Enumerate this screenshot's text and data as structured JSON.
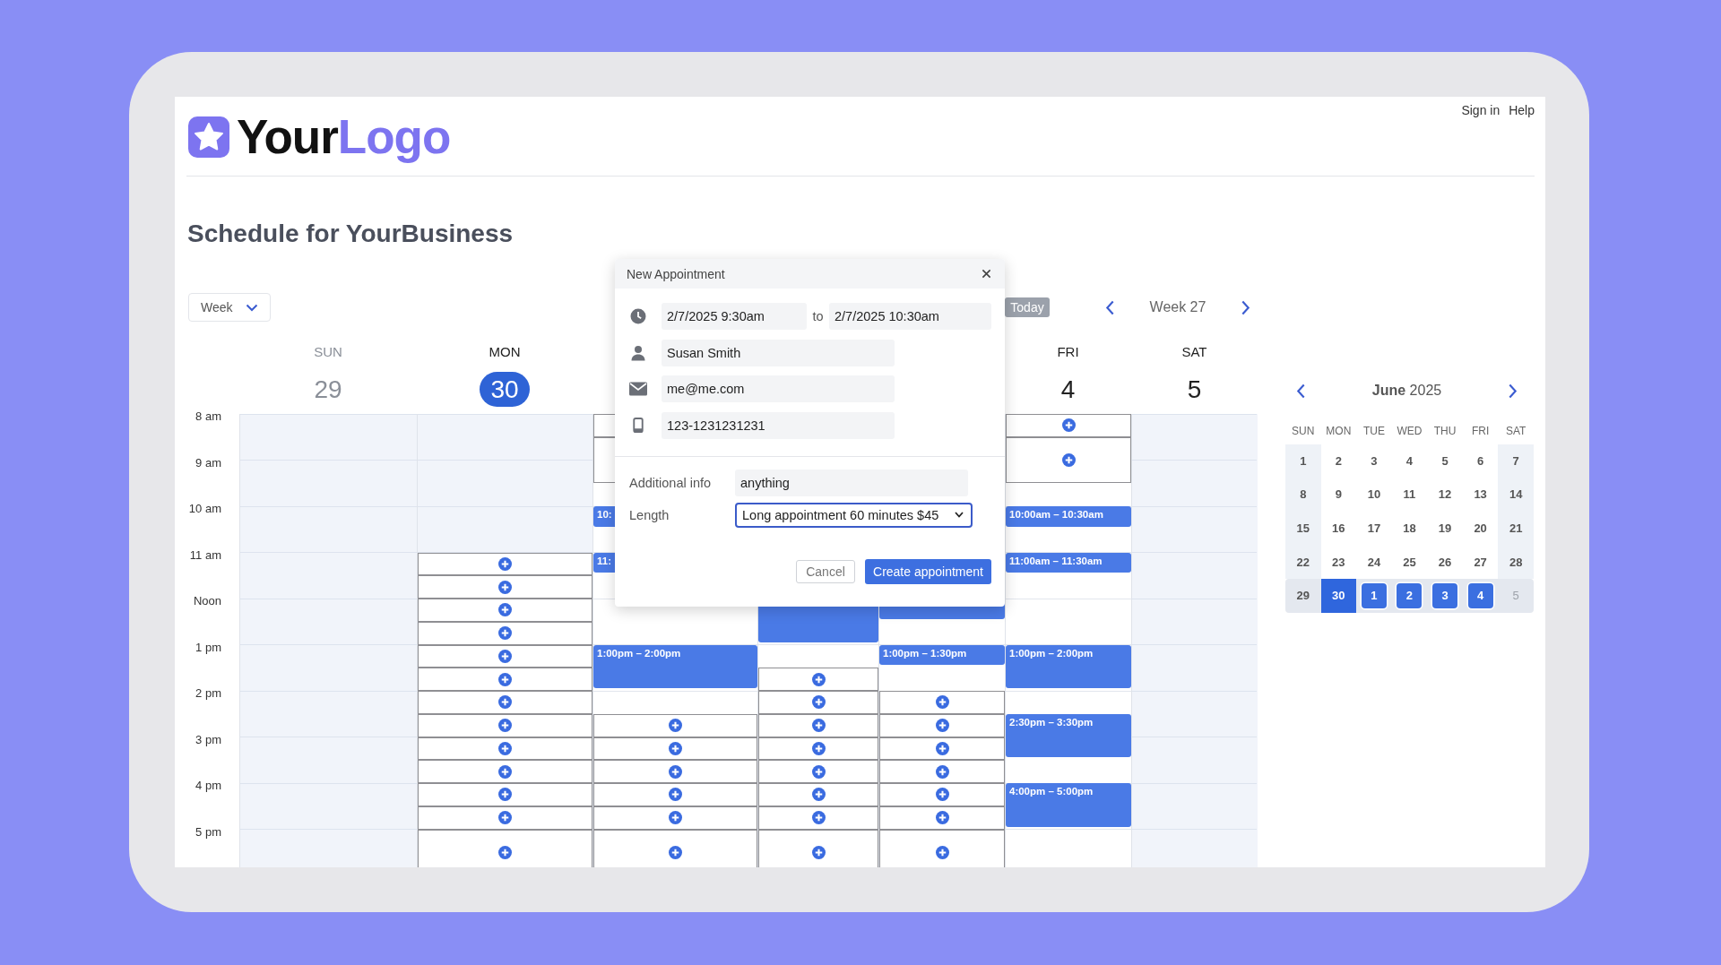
{
  "header": {
    "logo": {
      "parts": [
        "Your",
        "Logo"
      ]
    },
    "links": [
      "Sign in",
      "Help"
    ]
  },
  "title": "Schedule for YourBusiness",
  "toolbar": {
    "view": "Week",
    "today": "Today",
    "week": "Week 27"
  },
  "hours": [
    "8 am",
    "9 am",
    "10 am",
    "11 am",
    "Noon",
    "1 pm",
    "2 pm",
    "3 pm",
    "4 pm",
    "5 pm"
  ],
  "days": [
    {
      "weekday": "SUN",
      "date": "29",
      "selected": false,
      "muted": true,
      "slots": [
        {
          "kind": "closed-hour"
        },
        {
          "kind": "closed-hour"
        },
        {
          "kind": "closed-hour"
        },
        {
          "kind": "closed-hour"
        },
        {
          "kind": "closed-hour"
        },
        {
          "kind": "closed-hour"
        },
        {
          "kind": "closed-hour"
        },
        {
          "kind": "closed-hour"
        },
        {
          "kind": "closed-hour"
        },
        {
          "kind": "closed-hour"
        }
      ]
    },
    {
      "weekday": "MON",
      "date": "30",
      "selected": true,
      "muted": false,
      "slots": [
        {
          "kind": "closed-hour"
        },
        {
          "kind": "closed-hour"
        },
        {
          "kind": "closed-hour"
        },
        {
          "kind": "open"
        },
        {
          "kind": "open"
        },
        {
          "kind": "open"
        },
        {
          "kind": "open"
        },
        {
          "kind": "open"
        },
        {
          "kind": "open"
        },
        {
          "kind": "open"
        },
        {
          "kind": "open"
        },
        {
          "kind": "open"
        },
        {
          "kind": "open"
        },
        {
          "kind": "open"
        },
        {
          "kind": "open"
        },
        {
          "kind": "open-hour"
        }
      ]
    },
    {
      "slots": [
        {
          "kind": "open-edge"
        },
        {
          "kind": "open-edge-hour"
        },
        {
          "kind": "blank"
        },
        {
          "kind": "booked",
          "label": "10:"
        },
        {
          "kind": "blank"
        },
        {
          "kind": "booked",
          "label": "11:"
        },
        {
          "kind": "blank"
        },
        {
          "kind": "blank-hour"
        },
        {
          "kind": "booked-hour",
          "label": "1:00pm – 2:00pm"
        },
        {
          "kind": "blank"
        },
        {
          "kind": "open"
        },
        {
          "kind": "open"
        },
        {
          "kind": "open"
        },
        {
          "kind": "open"
        },
        {
          "kind": "open"
        },
        {
          "kind": "open-hour"
        }
      ]
    },
    {
      "slots": [
        {
          "kind": "blank-hour"
        },
        {
          "kind": "blank-hour"
        },
        {
          "kind": "blank-hour"
        },
        {
          "kind": "blank-hour"
        },
        {
          "kind": "booked-hour"
        },
        {
          "kind": "blank"
        },
        {
          "kind": "open"
        },
        {
          "kind": "open"
        },
        {
          "kind": "open"
        },
        {
          "kind": "open"
        },
        {
          "kind": "open"
        },
        {
          "kind": "open"
        },
        {
          "kind": "open"
        },
        {
          "kind": "open-hour"
        }
      ]
    },
    {
      "slots": [
        {
          "kind": "blank-hour"
        },
        {
          "kind": "blank-hour"
        },
        {
          "kind": "blank-hour"
        },
        {
          "kind": "blank-hour"
        },
        {
          "kind": "booked"
        },
        {
          "kind": "blank"
        },
        {
          "kind": "booked",
          "label": "1:00pm – 1:30pm"
        },
        {
          "kind": "blank"
        },
        {
          "kind": "open"
        },
        {
          "kind": "open"
        },
        {
          "kind": "open"
        },
        {
          "kind": "open"
        },
        {
          "kind": "open"
        },
        {
          "kind": "open"
        },
        {
          "kind": "open-hour"
        }
      ]
    },
    {
      "weekday": "FRI",
      "date": "4",
      "selected": false,
      "muted": false,
      "slots": [
        {
          "kind": "open"
        },
        {
          "kind": "open-hour"
        },
        {
          "kind": "blank"
        },
        {
          "kind": "booked",
          "label": "10:00am – 10:30am"
        },
        {
          "kind": "blank"
        },
        {
          "kind": "booked",
          "label": "11:00am – 11:30am"
        },
        {
          "kind": "blank"
        },
        {
          "kind": "blank-hour"
        },
        {
          "kind": "booked-hour",
          "label": "1:00pm – 2:00pm"
        },
        {
          "kind": "blank"
        },
        {
          "kind": "booked-hour",
          "label": "2:30pm – 3:30pm"
        },
        {
          "kind": "blank"
        },
        {
          "kind": "booked-hour",
          "label": "4:00pm – 5:00pm"
        },
        {
          "kind": "blank-hour"
        }
      ]
    },
    {
      "weekday": "SAT",
      "date": "5",
      "selected": false,
      "muted": false,
      "slots": [
        {
          "kind": "closed-hour"
        },
        {
          "kind": "closed-hour"
        },
        {
          "kind": "closed-hour"
        },
        {
          "kind": "closed-hour"
        },
        {
          "kind": "closed-hour"
        },
        {
          "kind": "closed-hour"
        },
        {
          "kind": "closed-hour"
        },
        {
          "kind": "closed-hour"
        },
        {
          "kind": "closed-hour"
        },
        {
          "kind": "closed-hour"
        }
      ]
    }
  ],
  "mini_calendar": {
    "month": "**June** 2025",
    "weekdays": [
      "SUN",
      "MON",
      "TUE",
      "WED",
      "THU",
      "FRI",
      "SAT"
    ],
    "weeks": [
      {
        "current": false,
        "days": [
          {
            "label": "1",
            "kind": "day",
            "selected": false
          },
          {
            "label": "2",
            "kind": "day",
            "selected": false
          },
          {
            "label": "3",
            "kind": "day",
            "selected": false
          },
          {
            "label": "4",
            "kind": "day",
            "selected": false
          },
          {
            "label": "5",
            "kind": "day",
            "selected": false
          },
          {
            "label": "6",
            "kind": "day",
            "selected": false
          },
          {
            "label": "7",
            "kind": "day",
            "selected": false
          }
        ]
      },
      {
        "current": false,
        "days": [
          {
            "label": "8",
            "kind": "day",
            "selected": false
          },
          {
            "label": "9",
            "kind": "day",
            "selected": false
          },
          {
            "label": "10",
            "kind": "day",
            "selected": false
          },
          {
            "label": "11",
            "kind": "day",
            "selected": false
          },
          {
            "label": "12",
            "kind": "day",
            "selected": false
          },
          {
            "label": "13",
            "kind": "day",
            "selected": false
          },
          {
            "label": "14",
            "kind": "day",
            "selected": false
          }
        ]
      },
      {
        "current": false,
        "days": [
          {
            "label": "15",
            "kind": "day",
            "selected": false
          },
          {
            "label": "16",
            "kind": "day",
            "selected": false
          },
          {
            "label": "17",
            "kind": "day",
            "selected": false
          },
          {
            "label": "18",
            "kind": "day",
            "selected": false
          },
          {
            "label": "19",
            "kind": "day",
            "selected": false
          },
          {
            "label": "20",
            "kind": "day",
            "selected": false
          },
          {
            "label": "21",
            "kind": "day",
            "selected": false
          }
        ]
      },
      {
        "current": false,
        "days": [
          {
            "label": "22",
            "kind": "day",
            "selected": false
          },
          {
            "label": "23",
            "kind": "day",
            "selected": false
          },
          {
            "label": "24",
            "kind": "day",
            "selected": false
          },
          {
            "label": "25",
            "kind": "day",
            "selected": false
          },
          {
            "label": "26",
            "kind": "day",
            "selected": false
          },
          {
            "label": "27",
            "kind": "day",
            "selected": false
          },
          {
            "label": "28",
            "kind": "day",
            "selected": false
          }
        ]
      },
      {
        "current": true,
        "days": [
          {
            "label": "29",
            "kind": "day",
            "selected": false
          },
          {
            "label": "30",
            "kind": "day",
            "selected": true
          },
          {
            "label": "1",
            "kind": "marked",
            "selected": false
          },
          {
            "label": "2",
            "kind": "marked",
            "selected": false
          },
          {
            "label": "3",
            "kind": "marked",
            "selected": false
          },
          {
            "label": "4",
            "kind": "marked",
            "selected": false
          },
          {
            "label": "5",
            "kind": "muted",
            "selected": false
          }
        ]
      }
    ]
  },
  "dialog": {
    "title": "New Appointment",
    "start": "2/7/2025 9:30am",
    "to": "to",
    "end": "2/7/2025 10:30am",
    "name": "Susan Smith",
    "email": "me@me.com",
    "phone": "123-1231231231",
    "extra": {
      "label": "Additional info",
      "value": "anything"
    },
    "length": {
      "label": "Length",
      "value": "Long appointment 60 minutes $45"
    },
    "buttons": {
      "cancel": "Cancel",
      "create": "Create appointment"
    }
  }
}
